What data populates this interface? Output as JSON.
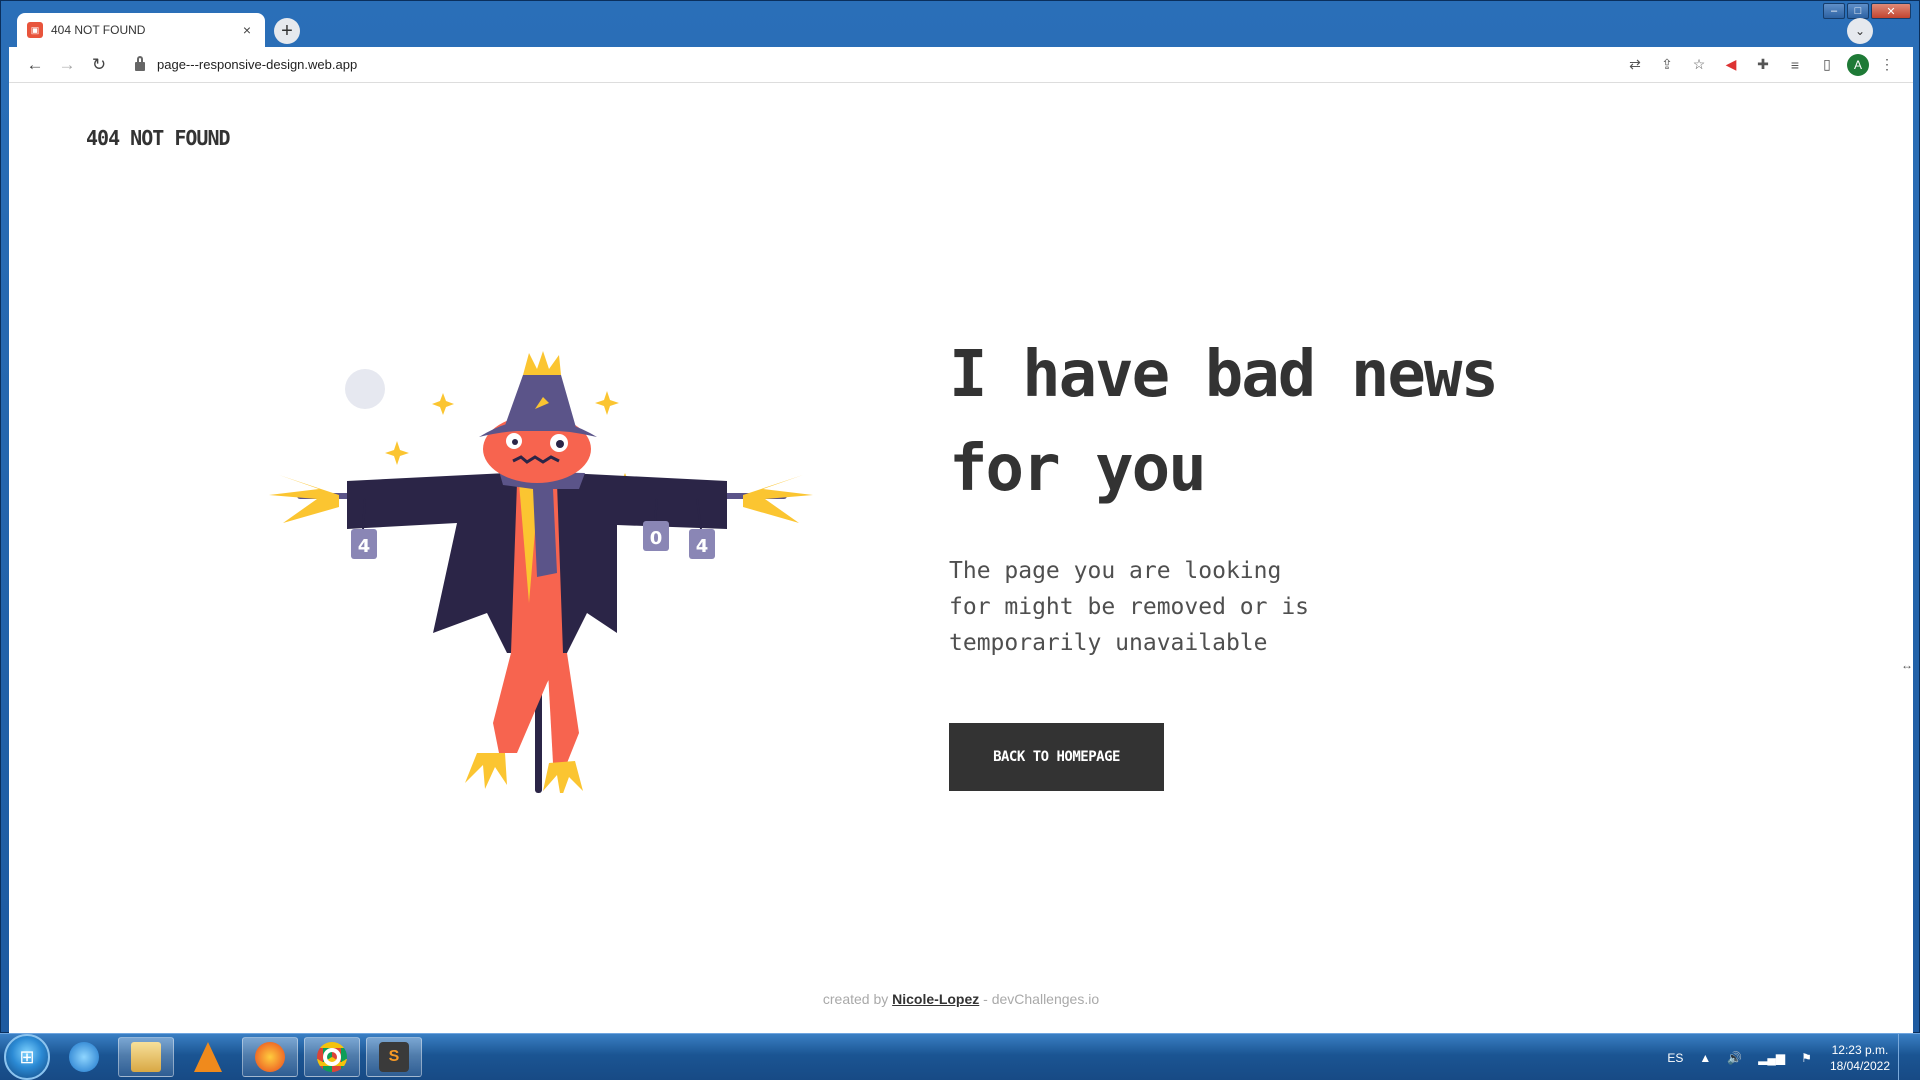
{
  "browser": {
    "tab": {
      "title": "404 NOT FOUND",
      "close": "×"
    },
    "new_tab": "+",
    "url": "page---responsive-design.web.app",
    "profile_initial": "A"
  },
  "page": {
    "brand": "404 NOT FOUND",
    "headline_line1": "I have bad news",
    "headline_line2": "for you",
    "description_line1": "The page you are looking",
    "description_line2": "for might be removed or is",
    "description_line3": "temporarily unavailable",
    "cta_label": "BACK TO HOMEPAGE",
    "footer_prefix": "created by",
    "footer_author": "Nicole-Lopez",
    "footer_suffix": "- devChallenges.io",
    "can_left": "4",
    "can_mid": "0",
    "can_right": "4"
  },
  "taskbar": {
    "language": "ES",
    "time": "12:23 p.m.",
    "date": "18/04/2022"
  },
  "colors": {
    "text_dark": "#333333",
    "scarecrow_orange": "#f7644f",
    "scarecrow_purple": "#5b5489",
    "coat": "#2b2547",
    "straw": "#fbc531"
  }
}
